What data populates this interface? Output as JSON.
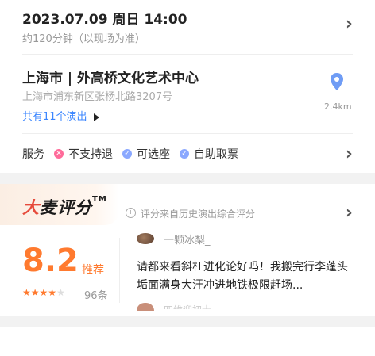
{
  "show_time": {
    "date": "2023.07.09 周日 14:00",
    "duration": "约120分钟（以现场为准）"
  },
  "venue": {
    "name": "上海市 | 外高桥文化艺术中心",
    "address": "上海市浦东新区张杨北路3207号",
    "shows_link": "共有11个演出",
    "distance": "2.4km",
    "pin_color": "#6f9cf5"
  },
  "services": {
    "label": "服务",
    "items": [
      {
        "label": "不支持退",
        "icon": "x-circle-icon",
        "color": "#ff6b9a"
      },
      {
        "label": "可选座",
        "icon": "check-circle-icon",
        "color": "#8aa8ff"
      },
      {
        "label": "自助取票",
        "icon": "check-circle-icon",
        "color": "#8aa8ff"
      }
    ]
  },
  "rating": {
    "brand_fire": "大",
    "brand_rest": "麦评分",
    "brand_tm": "TM",
    "source_note": "评分来自历史演出综合评分",
    "score": "8.2",
    "recommend": "推荐",
    "stars_filled": 4,
    "stars_total": 5,
    "count": "96条",
    "accent_color": "#ff7a2f"
  },
  "review": {
    "user": "一颗冰梨_",
    "text": "请都来看斜杠进化论好吗！我搬完行李蓬头垢面满身大汗冲进地铁极限赶场...",
    "next_user": "四维迎初十"
  }
}
